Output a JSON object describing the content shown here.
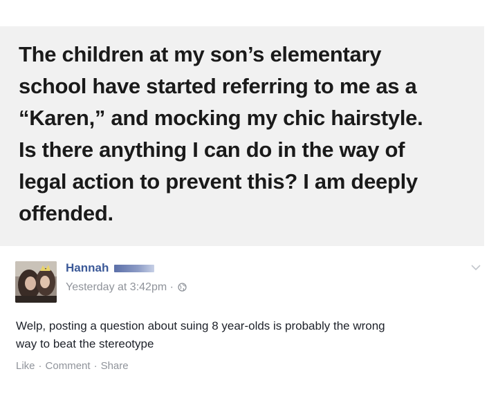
{
  "post": {
    "lines": [
      "The children at my son’s elementary",
      "school have started referring to me as a",
      "“Karen,” and mocking my chic hairstyle.",
      "Is there anything I can do in the way of",
      "legal action to prevent this? I am deeply",
      "offended."
    ]
  },
  "comment": {
    "author": "Hannah",
    "timestamp": "Yesterday at 3:42pm",
    "separator": "·",
    "privacy_icon": "globe-icon",
    "options_icon": "chevron-down-icon",
    "body_lines": [
      "Welp, posting a question about suing 8 year-olds is probably the wrong",
      "way to beat the stereotype"
    ],
    "actions": {
      "like": "Like",
      "comment": "Comment",
      "share": "Share",
      "separator": "·"
    }
  },
  "colors": {
    "post_background": "#f1f1f1",
    "author_link": "#3b5998",
    "meta_text": "#8f939a",
    "body_text": "#1d2129"
  }
}
